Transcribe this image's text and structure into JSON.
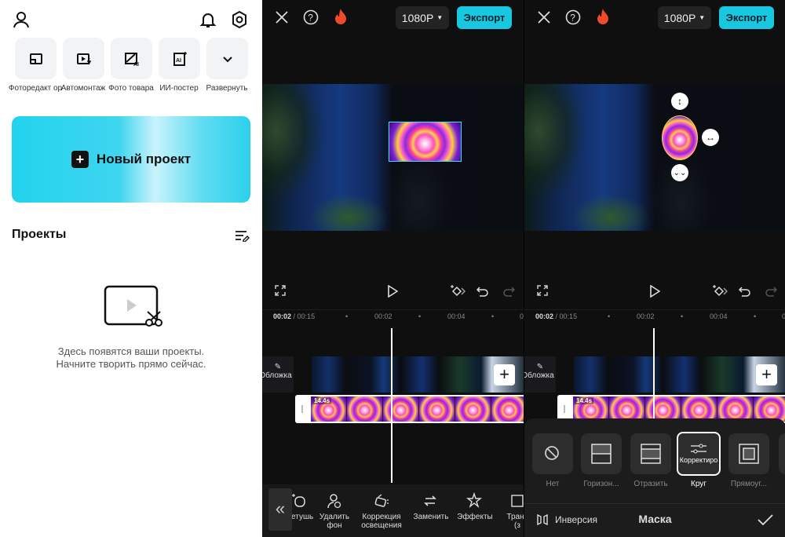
{
  "home": {
    "icons": {
      "profile": "user-icon",
      "notifications": "bell-icon",
      "settings": "gear-icon"
    },
    "tools": [
      {
        "label": "Фоторедакт ор",
        "icon": "photo-edit-icon"
      },
      {
        "label": "Автомонтаж",
        "icon": "auto-edit-icon"
      },
      {
        "label": "Фото товара",
        "icon": "product-photo-ai-icon"
      },
      {
        "label": "ИИ-постер",
        "icon": "ai-poster-icon"
      },
      {
        "label": "Развернуть",
        "icon": "chevron-down-icon"
      }
    ],
    "new_project": "Новый проект",
    "projects_title": "Проекты",
    "empty_line1": "Здесь появятся ваши проекты.",
    "empty_line2": "Начните творить прямо сейчас."
  },
  "editors": [
    {
      "resolution": "1080P",
      "export": "Экспорт",
      "time_current": "00:02",
      "time_total": "/ 00:15",
      "ticks": [
        "00:02",
        "00:04",
        "0"
      ],
      "cover": "Обложка",
      "clip_duration": "14.4s",
      "toolbar": [
        {
          "label": "Ретушь",
          "icon": "retouch-icon"
        },
        {
          "label": "Удалить\nфон",
          "icon": "remove-bg-icon"
        },
        {
          "label": "Коррекция\nосвещения",
          "icon": "lighting-icon"
        },
        {
          "label": "Заменить",
          "icon": "replace-icon"
        },
        {
          "label": "Эффекты",
          "icon": "effects-icon"
        },
        {
          "label": "Транс\n(з",
          "icon": "transform-icon"
        }
      ]
    },
    {
      "resolution": "1080P",
      "export": "Экспорт",
      "time_current": "00:02",
      "time_total": "/ 00:15",
      "ticks": [
        "00:02",
        "00:04",
        "0"
      ],
      "cover": "Обложка",
      "clip_duration": "14.4s",
      "mask": {
        "title": "Маска",
        "invert": "Инверсия",
        "selected": "Круг",
        "tooltip": "Корректиро",
        "options": [
          {
            "label": "Нет",
            "icon": "none-icon"
          },
          {
            "label": "Горизон...",
            "icon": "horizontal-mask-icon"
          },
          {
            "label": "Отразить",
            "icon": "mirror-mask-icon"
          },
          {
            "label": "Круг",
            "icon": "circle-mask-icon"
          },
          {
            "label": "Прямоуг...",
            "icon": "rectangle-mask-icon"
          }
        ]
      }
    }
  ],
  "colors": {
    "accent": "#18c7e0",
    "dark_bg": "#0f0f0f"
  }
}
